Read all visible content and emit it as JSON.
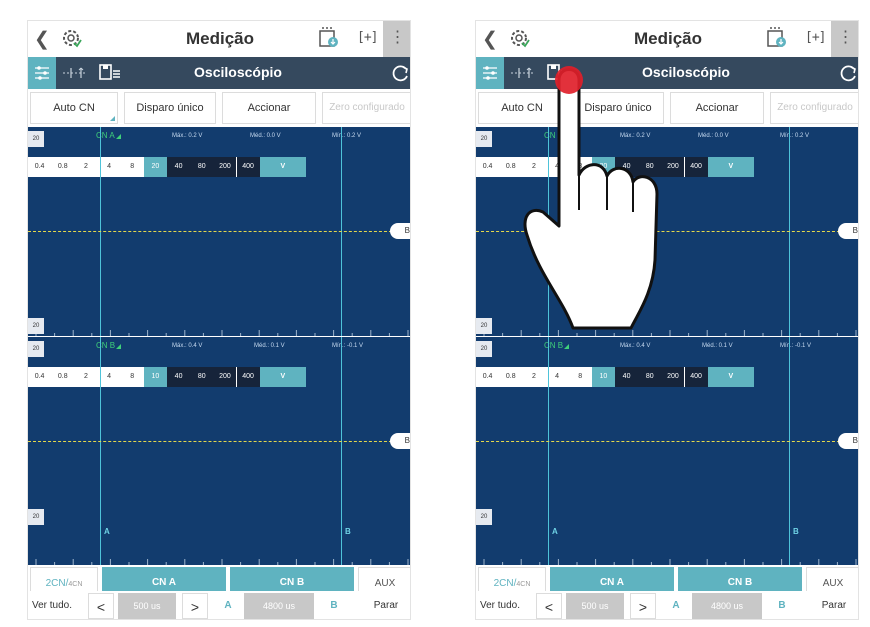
{
  "header": {
    "back_icon": "chevron-left-icon",
    "diagnostic_icon": "diagnostic-gear-icon",
    "title": "Medição",
    "download_icon": "download-icon",
    "fullscreen_label": "[+]",
    "more_icon": "more-vertical-icon"
  },
  "toolbar": {
    "settings_icon": "sliders-icon",
    "cursor_icon": "cursor-measure-icon",
    "save_icon": "save-icon",
    "title": "Osciloscópio",
    "refresh_icon": "refresh-icon"
  },
  "actions": {
    "auto": "Auto CN",
    "single_trigger": "Disparo único",
    "activate": "Accionar",
    "zero": "Zero configurado"
  },
  "channel_a": {
    "label": "CN A",
    "max": "Máx.: 0.2 V",
    "avg": "Méd.: 0.0 V",
    "min": "Mín.: 0.2 V",
    "edge_top": "20",
    "edge_bottom": "20",
    "scale": [
      "0.4",
      "0.8",
      "2",
      "4",
      "8",
      "20",
      "40",
      "80",
      "200",
      "400",
      "V"
    ],
    "scale_selected": "20",
    "marker": "B"
  },
  "channel_b": {
    "label": "CN B",
    "max": "Máx.: 0.4 V",
    "avg": "Méd.: 0.1 V",
    "min": "Mín.: -0.1 V",
    "edge_top": "20",
    "edge_bottom": "20",
    "scale": [
      "0.4",
      "0.8",
      "2",
      "4",
      "8",
      "10",
      "40",
      "80",
      "200",
      "400",
      "V"
    ],
    "scale_selected": "10",
    "marker": "B"
  },
  "cursors": {
    "a": "A",
    "b": "B"
  },
  "channel_bar": {
    "mode": "2CN/",
    "mode_sub": "4CN",
    "ch_a": "CN A",
    "ch_b": "CN B",
    "aux": "AUX"
  },
  "bottom_bar": {
    "view_all": "Ver tudo.",
    "prev": "<",
    "timebase": "500 us",
    "next": ">",
    "cursor_a": "A",
    "delta": "4800 us",
    "cursor_b": "B",
    "stop": "Parar"
  },
  "colors": {
    "accent": "#5fb3c0",
    "toolbar": "#35495e",
    "scope_bg": "#123c6e",
    "trace": "#e5d84a",
    "channel_label": "#3fd07a",
    "touch_point": "#e0202a"
  },
  "gesture": {
    "type": "tap",
    "target": "save-icon"
  }
}
